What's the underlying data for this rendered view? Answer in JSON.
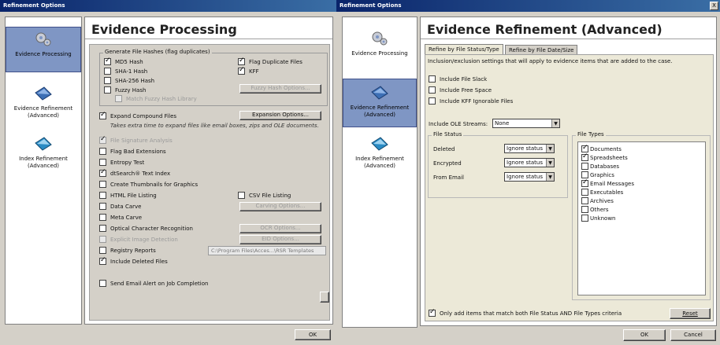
{
  "left": {
    "title": "Refinement Options",
    "nav": [
      {
        "label": "Evidence Processing"
      },
      {
        "label": "Evidence Refinement (Advanced)"
      },
      {
        "label": "Index Refinement (Advanced)"
      }
    ],
    "heading": "Evidence Processing",
    "hash_group": {
      "label": "Generate File Hashes (flag duplicates)",
      "md5": "MD5 Hash",
      "sha1": "SHA-1 Hash",
      "sha256": "SHA-256 Hash",
      "fuzzy": "Fuzzy Hash",
      "match_fuzzy": "Match Fuzzy Hash Library",
      "flag_dup": "Flag Duplicate Files",
      "kff": "KFF",
      "fuzzy_btn": "Fuzzy Hash Options..."
    },
    "expand": "Expand Compound Files",
    "expansion_btn": "Expansion Options...",
    "expand_note": "Takes extra time to expand files like email boxes, zips and OLE documents.",
    "options": {
      "file_sig": "File Signature Analysis",
      "flag_bad": "Flag Bad Extensions",
      "entropy": "Entropy Test",
      "dtsearch": "dtSearch® Text Index",
      "thumbs": "Create Thumbnails for Graphics",
      "html": "HTML File Listing",
      "csv": "CSV File Listing",
      "carve": "Data Carve",
      "carving_btn": "Carving Options...",
      "meta": "Meta Carve",
      "ocr": "Optical Character Recognition",
      "ocr_btn": "OCR Options...",
      "eid": "Explicit Image Detection",
      "eid_btn": "EID Options...",
      "registry": "Registry Reports",
      "registry_path": "C:\\Program Files\\Acces...\\RSR Templates",
      "deleted": "Include Deleted Files",
      "email_alert": "Send Email Alert on Job Completion"
    },
    "ok": "OK"
  },
  "right": {
    "title": "Refinement Options",
    "close": "X",
    "nav": [
      {
        "label": "Evidence Processing"
      },
      {
        "label": "Evidence Refinement (Advanced)"
      },
      {
        "label": "Index Refinement (Advanced)"
      }
    ],
    "heading": "Evidence Refinement (Advanced)",
    "tabs": [
      "Refine by File Status/Type",
      "Refine by File Date/Size"
    ],
    "desc": "Inclusion/exclusion settings that will apply to evidence items that are added to the case.",
    "include_slack": "Include File Slack",
    "include_free": "Include Free Space",
    "include_kff": "Include KFF Ignorable Files",
    "ole_label": "Include OLE Streams:",
    "ole_value": "None",
    "file_status_label": "File Status",
    "status": [
      {
        "label": "Deleted",
        "value": "Ignore status"
      },
      {
        "label": "Encrypted",
        "value": "Ignore status"
      },
      {
        "label": "From Email",
        "value": "Ignore status"
      }
    ],
    "file_types_label": "File Types",
    "file_types": [
      {
        "label": "Documents",
        "checked": true
      },
      {
        "label": "Spreadsheets",
        "checked": true
      },
      {
        "label": "Databases",
        "checked": false
      },
      {
        "label": "Graphics",
        "checked": false
      },
      {
        "label": "Email Messages",
        "checked": true
      },
      {
        "label": "Executables",
        "checked": false
      },
      {
        "label": "Archives",
        "checked": false
      },
      {
        "label": "Others",
        "checked": false
      },
      {
        "label": "Unknown",
        "checked": false
      }
    ],
    "only_add": "Only add items that match both File Status AND File Types criteria",
    "reset": "Reset",
    "ok": "OK",
    "cancel": "Cancel"
  },
  "icons": {
    "gear": "gear-icon",
    "refine": "refinement-icon",
    "index": "index-icon"
  },
  "colors": {
    "titlebar": "#0a246a",
    "selected_nav": "#7f96c4",
    "window_bg": "#d4d0c8"
  }
}
